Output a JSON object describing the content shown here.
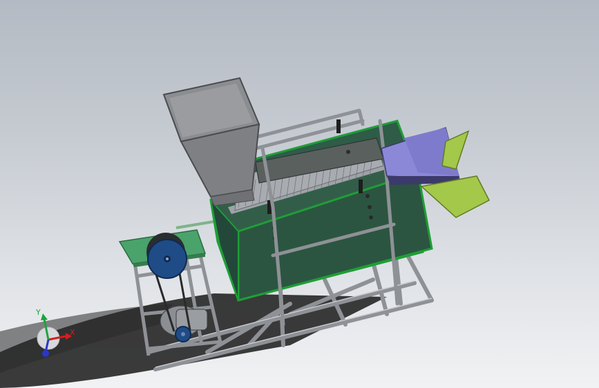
{
  "triad": {
    "x_label": "X",
    "y_label": "Y",
    "z_label": "",
    "x_color": "#d21f1f",
    "y_color": "#1fa33b",
    "z_color": "#2a37c8"
  },
  "colors": {
    "frame": "#8f9297",
    "hopper": "#8b8d90",
    "box_face": "#2f5a47",
    "box_edge": "#22a53a",
    "screen_mesh": "#9fa3a8",
    "chute": "#8c88d8",
    "outlet_tray": "#a3c84a",
    "motor_platform": "#4aa36a",
    "pulley": "#1f4c86",
    "shadow": "#1e1e1e"
  }
}
